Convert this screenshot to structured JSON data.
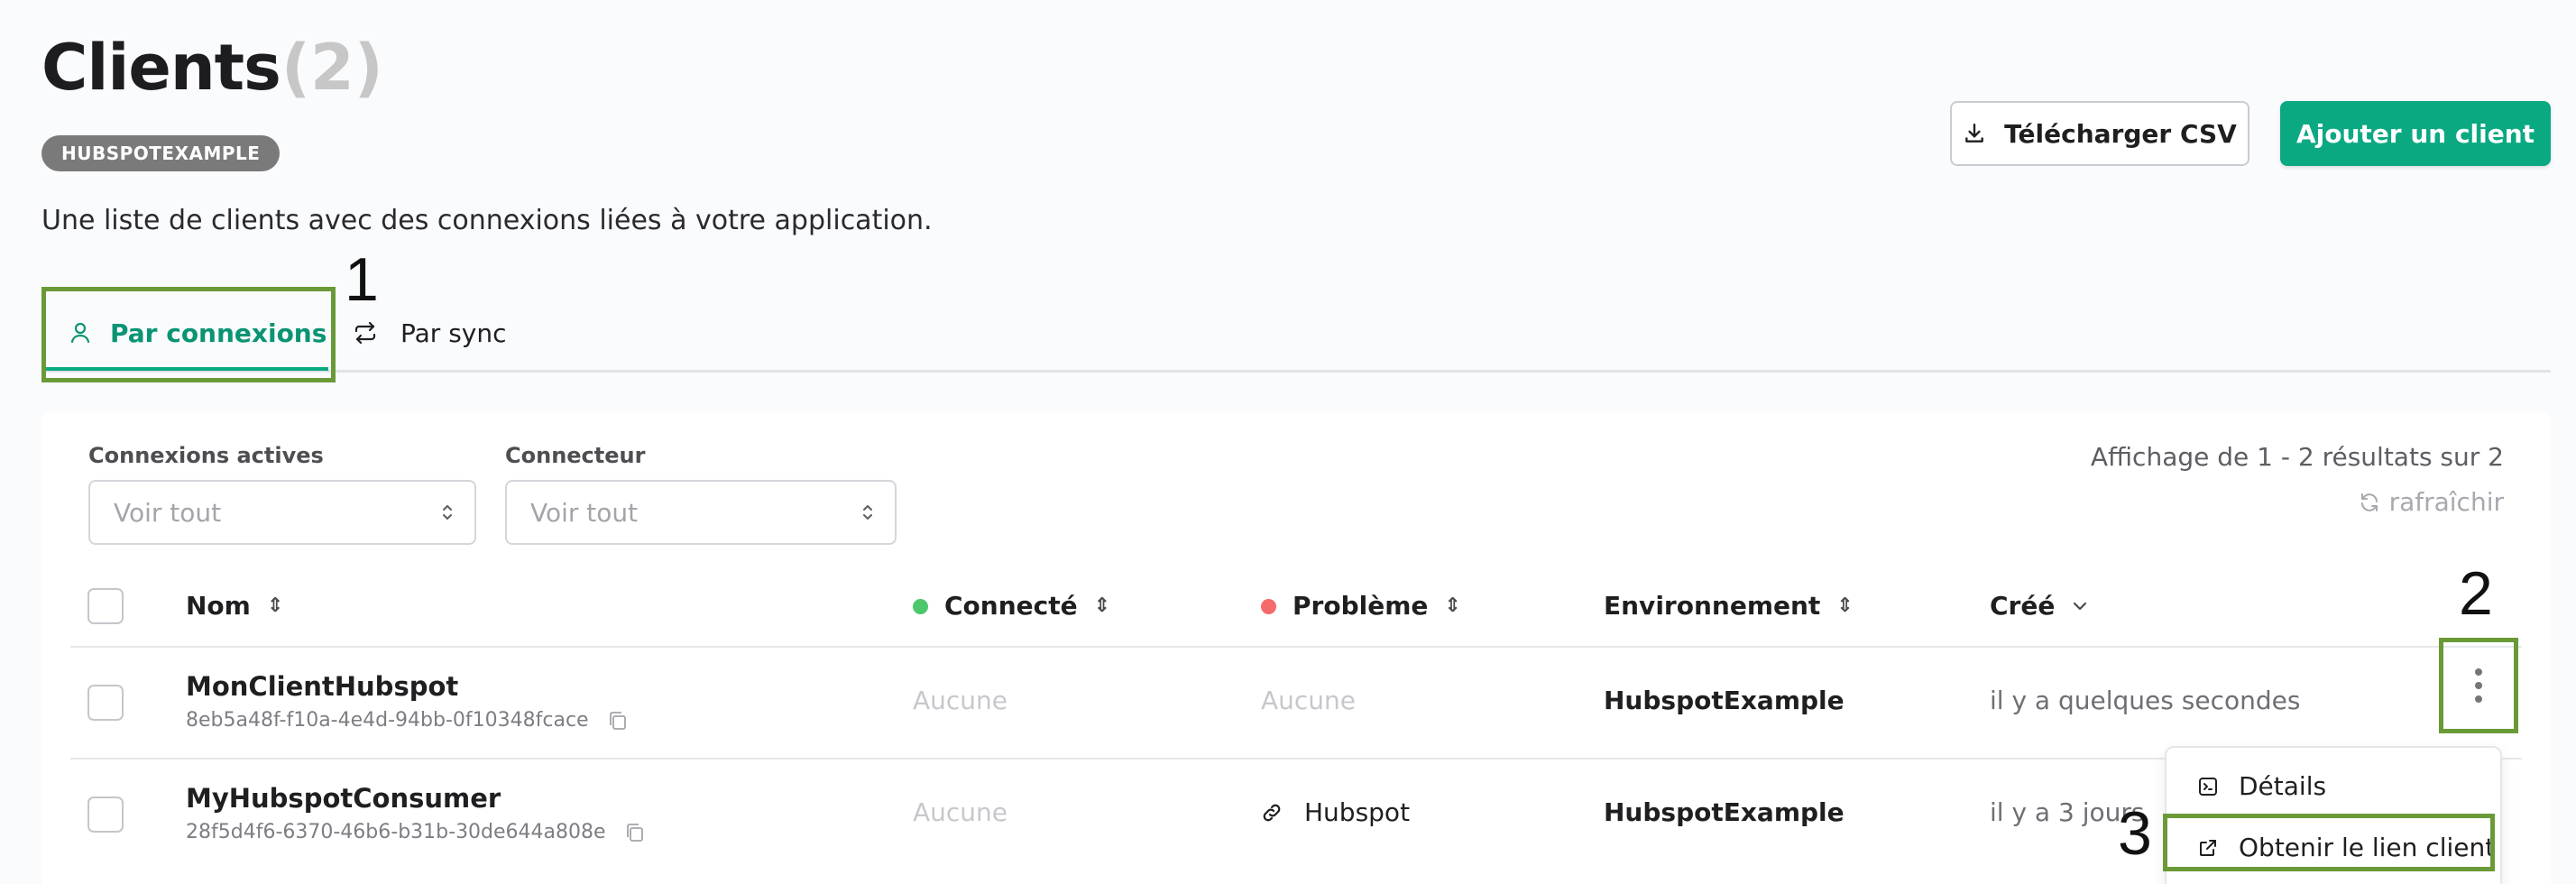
{
  "header": {
    "title": "Clients",
    "count": "(2)",
    "badge": "HUBSPOTEXAMPLE",
    "subtitle": "Une liste de clients avec des connexions liées à votre application.",
    "csv_button": "Télécharger CSV",
    "add_button": "Ajouter un client"
  },
  "tabs": [
    {
      "label": "Par connexions",
      "active": true,
      "icon": "user-icon"
    },
    {
      "label": "Par sync",
      "active": false,
      "icon": "sync-arrows-icon"
    }
  ],
  "annotations": [
    "1",
    "2",
    "3"
  ],
  "filters": [
    {
      "label": "Connexions actives",
      "value": "Voir tout"
    },
    {
      "label": "Connecteur",
      "value": "Voir tout"
    }
  ],
  "results_text": "Affichage de 1 - 2 résultats sur 2",
  "refresh_label": "rafraîchir",
  "table": {
    "columns": [
      "Nom",
      "Connecté",
      "Problème",
      "Environnement",
      "Créé"
    ],
    "rows": [
      {
        "name": "MonClientHubspot",
        "id": "8eb5a48f-f10a-4e4d-94bb-0f10348fcace",
        "connected": "Aucune",
        "problem": "Aucune",
        "environment": "HubspotExample",
        "created": "il y a quelques secondes"
      },
      {
        "name": "MyHubspotConsumer",
        "id": "28f5d4f6-6370-46b6-b31b-30de644a808e",
        "connected": "Aucune",
        "problem": "Hubspot",
        "environment": "HubspotExample",
        "created": "il y a 3 jours"
      }
    ]
  },
  "row_menu": {
    "items": [
      {
        "label": "Détails",
        "icon": "terminal-icon"
      },
      {
        "label": "Obtenir le lien client",
        "icon": "external-link-icon"
      }
    ]
  },
  "colors": {
    "accent": "#0aa982",
    "connected_dot": "#4cc76b",
    "problem_dot": "#f56a6a",
    "highlight_box": "#6a9a37",
    "badge": "#7a7a7a"
  }
}
